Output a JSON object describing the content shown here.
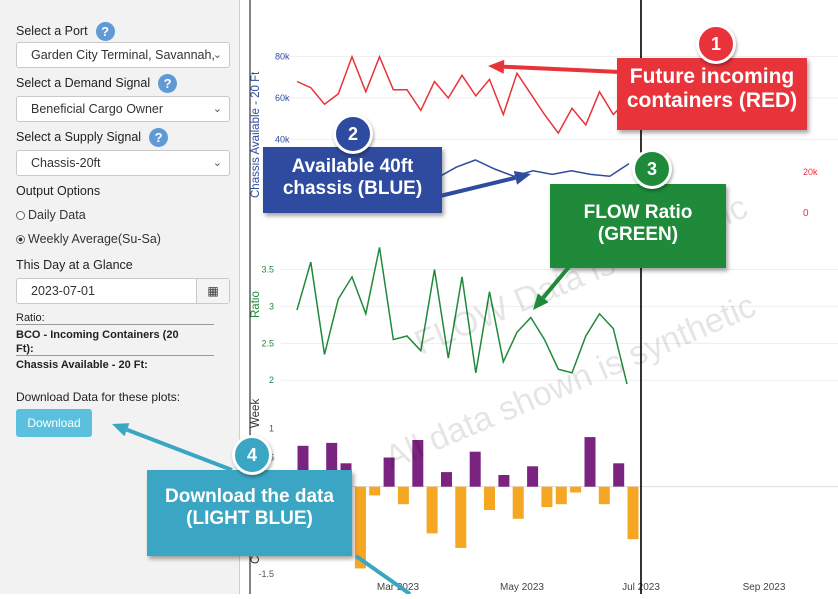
{
  "sidebar": {
    "port_label": "Select a Port",
    "port_value": "Garden City Terminal, Savannah,",
    "demand_label": "Select a Demand Signal",
    "demand_value": "Beneficial Cargo Owner",
    "supply_label": "Select a Supply Signal",
    "supply_value": "Chassis-20ft",
    "help_glyph": "?",
    "output_label": "Output Options",
    "output_options": [
      "Daily Data",
      "Weekly Average(Su-Sa)"
    ],
    "output_selected": "Weekly Average(Su-Sa)",
    "glance_label": "This Day at a Glance",
    "date_value": "2023-07-01",
    "ratio_label": "Ratio:",
    "bco_label_1": "BCO - Incoming Containers (20",
    "bco_label_2": "Ft):",
    "chassis_label": "Chassis Available - 20 Ft:",
    "download_prompt": "Download Data for these plots:",
    "download_button": "Download"
  },
  "colors": {
    "red": "#e8333a",
    "blue": "#2f4b9f",
    "green": "#1f8a3a",
    "lightblue": "#3aa6c4",
    "purple": "#7b2380",
    "orange": "#f5a623",
    "download": "#5bc0de"
  },
  "chart_data": {
    "type": "line",
    "x_ticks": [
      "Mar 2023",
      "May 2023",
      "Jul 2023",
      "Sep 2023"
    ],
    "marker_date": "2023-07-01",
    "panels": [
      {
        "name": "incoming-panel",
        "ylabel": "Chassis Available - 20 Ft",
        "ylim": [
          30,
          90
        ],
        "y_ticks": [
          "40k",
          "60k",
          "80k"
        ],
        "y_values": [
          40,
          60,
          80
        ],
        "right_tick": "20k",
        "right_tick_2": "0",
        "series": [
          {
            "color": "red",
            "values": [
              68,
              65,
              57,
              62,
              80,
              63,
              80,
              64,
              64,
              54,
              68,
              60,
              71,
              61,
              69,
              52,
              72,
              62,
              52,
              43,
              55,
              47,
              63,
              52,
              59
            ]
          },
          {
            "color": "blue",
            "values": [
              16,
              22,
              26,
              21,
              17,
              20,
              18,
              20,
              18,
              17,
              24
            ]
          }
        ]
      },
      {
        "name": "ratio-panel",
        "ylabel": "Ratio",
        "ylim": [
          1.8,
          3.9
        ],
        "y_ticks": [
          "2",
          "2.5",
          "3",
          "3.5"
        ],
        "y_values": [
          2,
          2.5,
          3,
          3.5
        ],
        "series": [
          {
            "color": "green",
            "values": [
              2.95,
              3.6,
              2.35,
              3.1,
              3.4,
              2.9,
              3.8,
              2.55,
              2.6,
              2.4,
              3.5,
              2.3,
              3.4,
              2.1,
              3.2,
              2.25,
              2.65,
              2.85,
              2.55,
              2.15,
              2.1,
              2.6,
              2.9,
              2.7,
              1.95
            ]
          }
        ]
      },
      {
        "name": "change-panel",
        "ylabel": "Week",
        "ylabel_2": "C",
        "ylim": [
          -1.6,
          1.4
        ],
        "y_ticks": [
          "-1.5",
          "0.5",
          "1"
        ],
        "y_values": [
          -1.5,
          0.5,
          1
        ],
        "series": [
          {
            "type": "bar",
            "values": [
              0.7,
              -0.3,
              0.75,
              0.4,
              -1.4,
              -0.15,
              0.5,
              -0.3,
              0.8,
              -0.8,
              0.25,
              -1.05,
              0.6,
              -0.4,
              0.2,
              -0.55,
              0.35,
              -0.35,
              -0.3,
              -0.1,
              0.85,
              -0.3,
              0.4,
              -0.9
            ]
          }
        ]
      }
    ]
  },
  "watermark": {
    "line1": "FLOW Data is synthetic",
    "line2": "All data shown is synthetic"
  },
  "callouts": [
    {
      "id": "1",
      "line1": "Future incoming",
      "line2": "containers (RED)",
      "color": "red"
    },
    {
      "id": "2",
      "line1": "Available 40ft",
      "line2": "chassis (BLUE)",
      "color": "blue"
    },
    {
      "id": "3",
      "line1": "FLOW Ratio",
      "line2": "(GREEN)",
      "color": "green"
    },
    {
      "id": "4",
      "line1": "Download the data",
      "line2": "(LIGHT BLUE)",
      "color": "lightblue"
    }
  ]
}
